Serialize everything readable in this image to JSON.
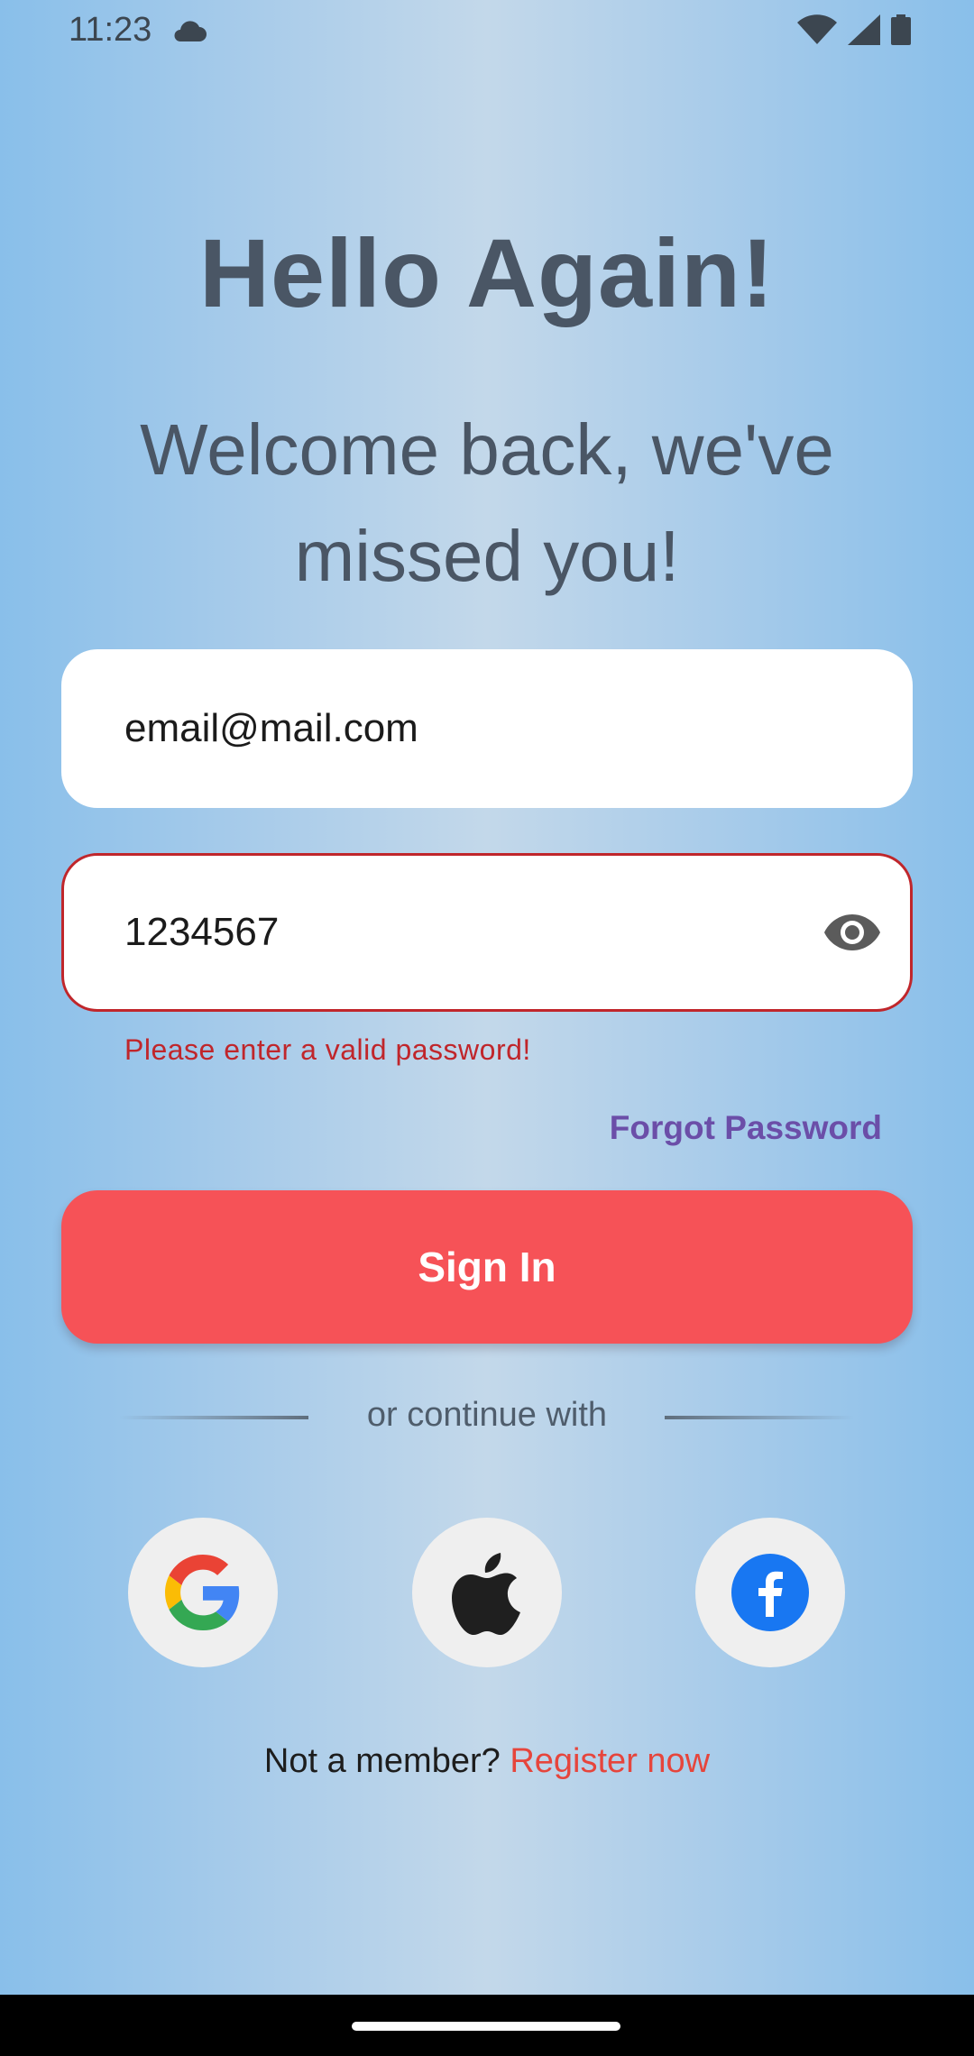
{
  "status_bar": {
    "time": "11:23"
  },
  "header": {
    "title": "Hello Again!",
    "subtitle": "Welcome back, we've missed you!"
  },
  "form": {
    "email_value": "email@mail.com",
    "password_value": "1234567",
    "password_error": "Please enter a valid password!",
    "forgot_password_label": "Forgot Password",
    "signin_label": "Sign In"
  },
  "divider": {
    "text": "or continue with"
  },
  "social": [
    {
      "icon": "google-icon"
    },
    {
      "icon": "apple-icon"
    },
    {
      "icon": "facebook-icon"
    }
  ],
  "footer": {
    "prompt": "Not a member?",
    "register_label": "Register now"
  },
  "colors": {
    "primary_button": "#f65257",
    "error": "#c0262b",
    "link_purple": "#6b4ea8",
    "link_red": "#e6453c",
    "heading_text": "#4a5665"
  }
}
